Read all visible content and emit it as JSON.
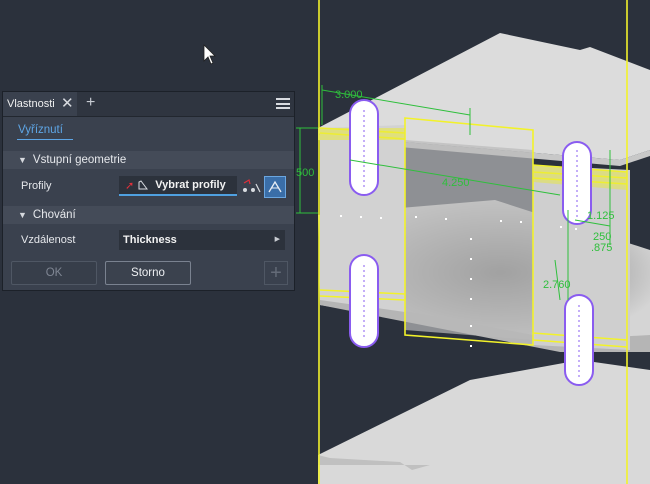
{
  "panel": {
    "tab_title": "Vlastnosti",
    "close_glyph": "✕",
    "add_tab_glyph": "+",
    "sub_tab": "Vyříznutí",
    "section1": {
      "title": "Vstupní geometrie",
      "row_label": "Profily",
      "picker_label": "Vybrat profily"
    },
    "section2": {
      "title": "Chování",
      "row_label": "Vzdálenost",
      "value": "Thickness"
    },
    "ok_label": "OK",
    "cancel_label": "Storno",
    "add_glyph": "+"
  },
  "dimensions": {
    "d1": "3.000",
    "d2": "4.250",
    "d3": "500",
    "d4": "1.125",
    "d5": "250",
    "d6": ".875",
    "d7": "2.760"
  },
  "colors": {
    "background": "#2b313c",
    "sketch_yellow": "#f2f22a",
    "dimension_green": "#2fbf3c",
    "slot_purple": "#8a5cf0",
    "accent_blue": "#4fa0e0"
  }
}
